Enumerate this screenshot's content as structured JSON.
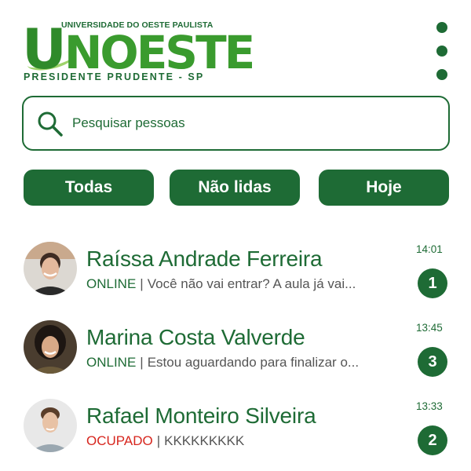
{
  "header": {
    "logo_top": "UNIVERSIDADE DO OESTE PAULISTA",
    "logo_first": "U",
    "logo_rest": "NOESTE",
    "logo_bottom": "PRESIDENTE PRUDENTE - SP",
    "menu_icon": "more-vertical-icon"
  },
  "search": {
    "icon": "search-icon",
    "placeholder": "Pesquisar pessoas",
    "value": ""
  },
  "filters": [
    {
      "label": "Todas"
    },
    {
      "label": "Não lidas"
    },
    {
      "label": "Hoje"
    }
  ],
  "contacts": [
    {
      "name": "Raíssa Andrade Ferreira",
      "status": "ONLINE",
      "separator": "|",
      "preview": "Você não vai entrar? A aula já vai...",
      "time": "14:01",
      "unread": "1"
    },
    {
      "name": "Marina Costa Valverde",
      "status": "ONLINE",
      "separator": "|",
      "preview": "Estou aguardando para finalizar o...",
      "time": "13:45",
      "unread": "3"
    },
    {
      "name": "Rafael Monteiro Silveira",
      "status": "OCUPADO",
      "separator": "|",
      "preview": "KKKKKKKKK",
      "time": "13:33",
      "unread": "2"
    }
  ],
  "colors": {
    "primary": "#1e6b35",
    "online": "#1e6b35",
    "busy": "#d7261e",
    "text_muted": "#555555"
  }
}
